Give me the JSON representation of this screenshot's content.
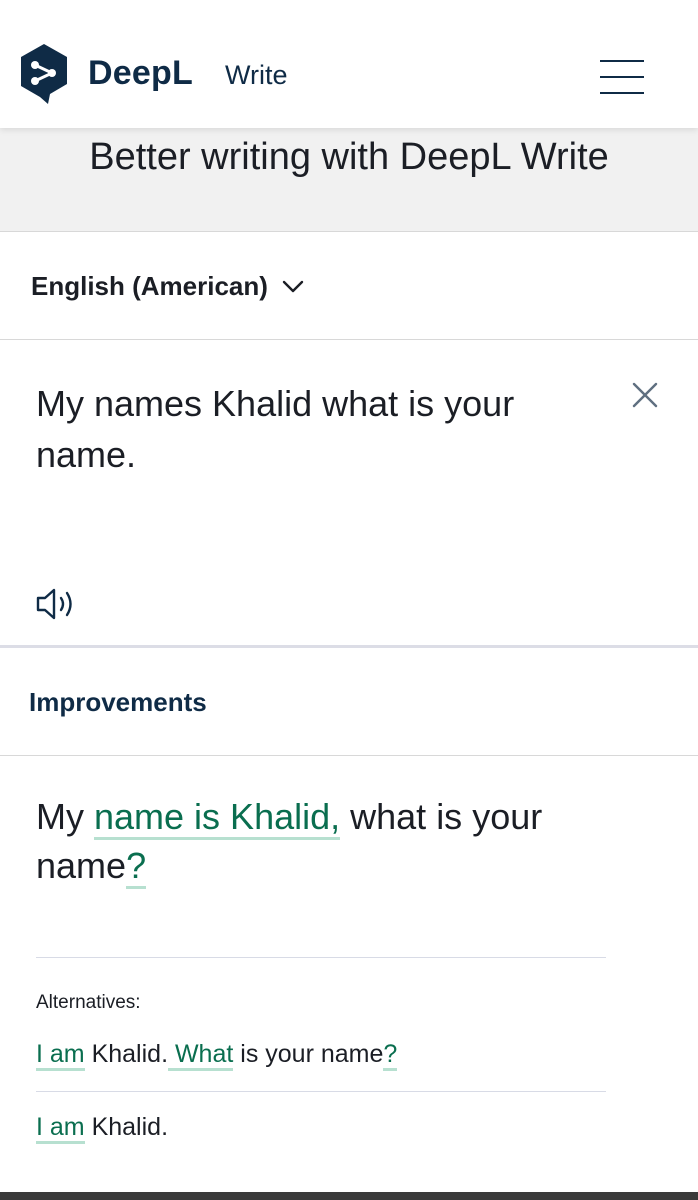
{
  "header": {
    "brand": "DeepL",
    "brand_sub": "Write",
    "colors": {
      "brand": "#0f2b46",
      "logo_bg": "#0f2b46"
    }
  },
  "page": {
    "title": "Better writing with DeepL Write"
  },
  "language": {
    "selected": "English (American)"
  },
  "input": {
    "text_line1": "My names Khalid what is your",
    "text_line2": "name."
  },
  "improvements": {
    "label": "Improvements",
    "line1": {
      "p1": "My ",
      "change1": "name is Khalid,",
      "p2": " what is your"
    },
    "line2": {
      "p1": "name",
      "change1": "?"
    },
    "highlight_color": "#0a6e4f",
    "underline_color": "#b7e0d0"
  },
  "alternatives": {
    "title": "Alternatives:",
    "items": [
      {
        "c1": "I am",
        "p1": " Khalid.",
        "c2": " What",
        "p2": " is your name",
        "c3": "?"
      },
      {
        "c1": "I am",
        "p1": " Khalid."
      }
    ]
  }
}
